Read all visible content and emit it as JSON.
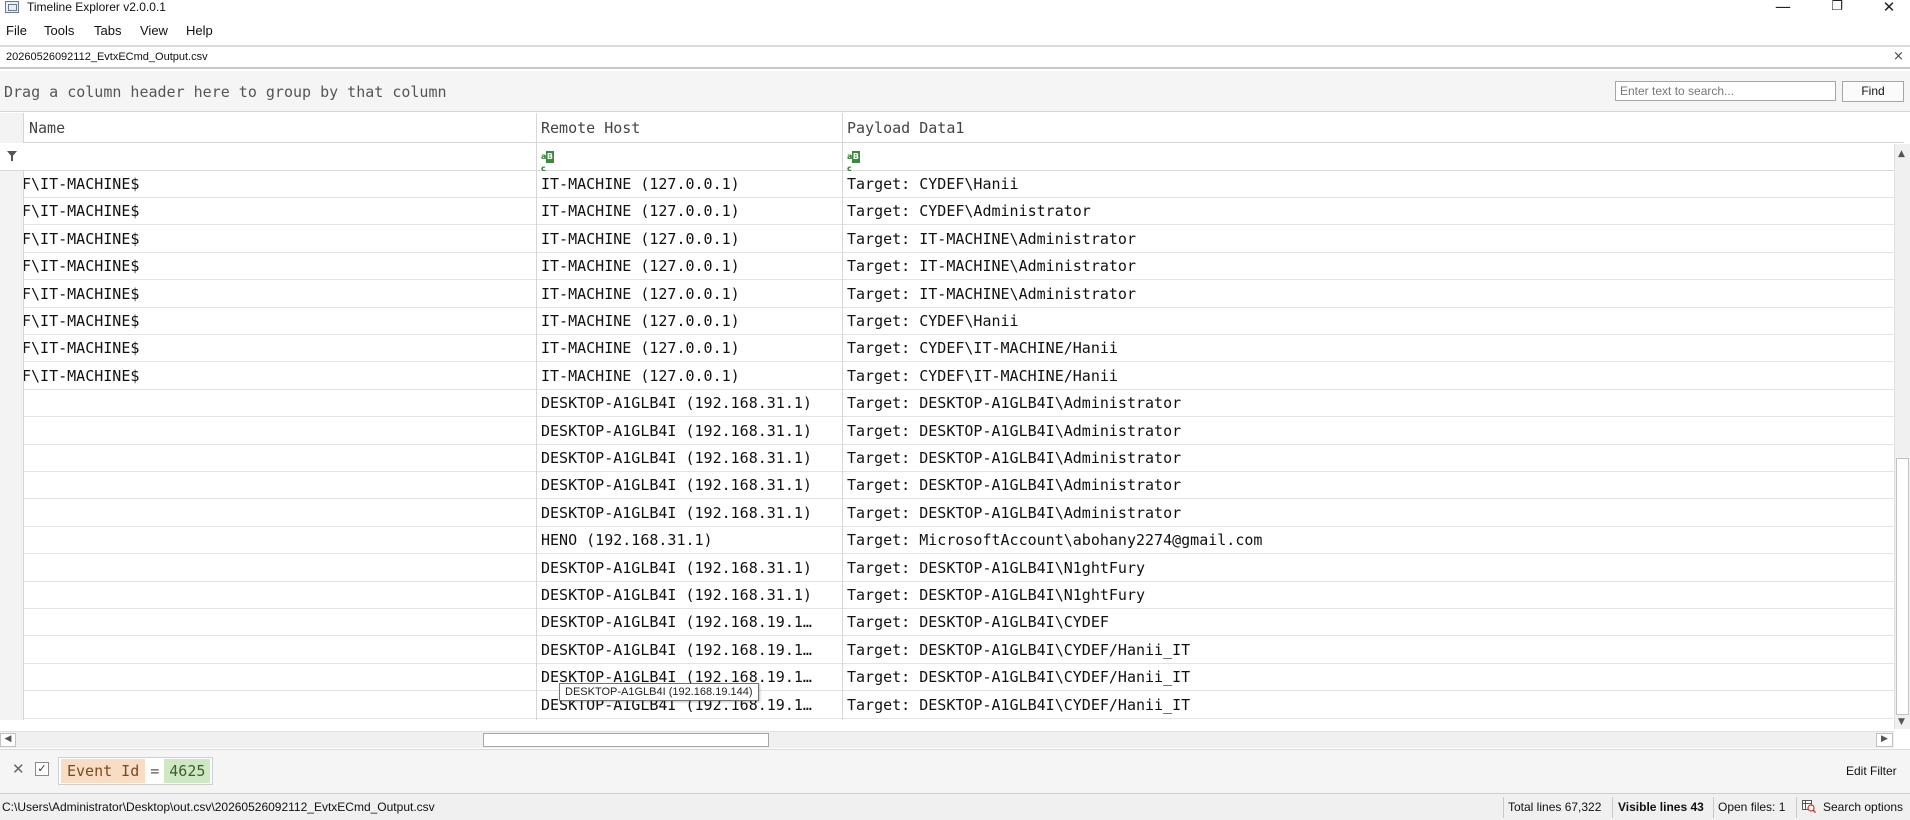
{
  "window": {
    "title": "Timeline Explorer v2.0.0.1",
    "controls": {
      "minimize": "—",
      "restore": "❐",
      "close": "✕"
    }
  },
  "menu": [
    "File",
    "Tools",
    "Tabs",
    "View",
    "Help"
  ],
  "file_tab": {
    "label": "20260526092112_EvtxECmd_Output.csv",
    "close": "×"
  },
  "group_panel": {
    "hint": "Drag a column header here to group by that column",
    "search_placeholder": "Enter text to search...",
    "find_label": "Find"
  },
  "grid": {
    "columns": [
      "Name",
      "Remote Host",
      "Payload Data1"
    ],
    "rows": [
      {
        "name": "F\\IT-MACHINE$",
        "remote": "IT-MACHINE (127.0.0.1)",
        "payload": "Target: CYDEF\\Hanii"
      },
      {
        "name": "F\\IT-MACHINE$",
        "remote": "IT-MACHINE (127.0.0.1)",
        "payload": "Target: CYDEF\\Administrator"
      },
      {
        "name": "F\\IT-MACHINE$",
        "remote": "IT-MACHINE (127.0.0.1)",
        "payload": "Target: IT-MACHINE\\Administrator"
      },
      {
        "name": "F\\IT-MACHINE$",
        "remote": "IT-MACHINE (127.0.0.1)",
        "payload": "Target: IT-MACHINE\\Administrator"
      },
      {
        "name": "F\\IT-MACHINE$",
        "remote": "IT-MACHINE (127.0.0.1)",
        "payload": "Target: IT-MACHINE\\Administrator"
      },
      {
        "name": "F\\IT-MACHINE$",
        "remote": "IT-MACHINE (127.0.0.1)",
        "payload": "Target: CYDEF\\Hanii"
      },
      {
        "name": "F\\IT-MACHINE$",
        "remote": "IT-MACHINE (127.0.0.1)",
        "payload": "Target: CYDEF\\IT-MACHINE/Hanii"
      },
      {
        "name": "F\\IT-MACHINE$",
        "remote": "IT-MACHINE (127.0.0.1)",
        "payload": "Target: CYDEF\\IT-MACHINE/Hanii"
      },
      {
        "name": "",
        "remote": "DESKTOP-A1GLB4I (192.168.31.1)",
        "payload": "Target: DESKTOP-A1GLB4I\\Administrator"
      },
      {
        "name": "",
        "remote": "DESKTOP-A1GLB4I (192.168.31.1)",
        "payload": "Target: DESKTOP-A1GLB4I\\Administrator"
      },
      {
        "name": "",
        "remote": "DESKTOP-A1GLB4I (192.168.31.1)",
        "payload": "Target: DESKTOP-A1GLB4I\\Administrator"
      },
      {
        "name": "",
        "remote": "DESKTOP-A1GLB4I (192.168.31.1)",
        "payload": "Target: DESKTOP-A1GLB4I\\Administrator"
      },
      {
        "name": "",
        "remote": "DESKTOP-A1GLB4I (192.168.31.1)",
        "payload": "Target: DESKTOP-A1GLB4I\\Administrator"
      },
      {
        "name": "",
        "remote": "HENO (192.168.31.1)",
        "payload": "Target: MicrosoftAccount\\abohany2274@gmail.com"
      },
      {
        "name": "",
        "remote": "DESKTOP-A1GLB4I (192.168.31.1)",
        "payload": "Target: DESKTOP-A1GLB4I\\N1ghtFury"
      },
      {
        "name": "",
        "remote": "DESKTOP-A1GLB4I (192.168.31.1)",
        "payload": "Target: DESKTOP-A1GLB4I\\N1ghtFury"
      },
      {
        "name": "",
        "remote": "DESKTOP-A1GLB4I (192.168.19.1…",
        "payload": "Target: DESKTOP-A1GLB4I\\CYDEF"
      },
      {
        "name": "",
        "remote": "DESKTOP-A1GLB4I (192.168.19.1…",
        "payload": "Target: DESKTOP-A1GLB4I\\CYDEF/Hanii_IT"
      },
      {
        "name": "",
        "remote": "DESKTOP-A1GLB4I (192.168.19.1…",
        "payload": "Target: DESKTOP-A1GLB4I\\CYDEF/Hanii_IT"
      },
      {
        "name": "",
        "remote": "DESKTOP-A1GLB4I (192.168.19.1…",
        "payload": "Target: DESKTOP-A1GLB4I\\CYDEF/Hanii_IT"
      }
    ],
    "tooltip": "DESKTOP-A1GLB4I (192.168.19.144)"
  },
  "filter_bar": {
    "field": "Event Id",
    "operator": "=",
    "value": "4625",
    "edit_label": "Edit Filter"
  },
  "status_bar": {
    "path": "C:\\Users\\Administrator\\Desktop\\out.csv\\20260526092112_EvtxECmd_Output.csv",
    "total_lines": "Total lines 67,322",
    "visible_lines": "Visible lines 43",
    "open_files": "Open files: 1",
    "search_options": "Search options"
  },
  "colors": {
    "filter_field_bg": "#f9dcc4",
    "filter_value_bg": "#cfe8c4",
    "abc_icon": "#3b8a3f"
  }
}
